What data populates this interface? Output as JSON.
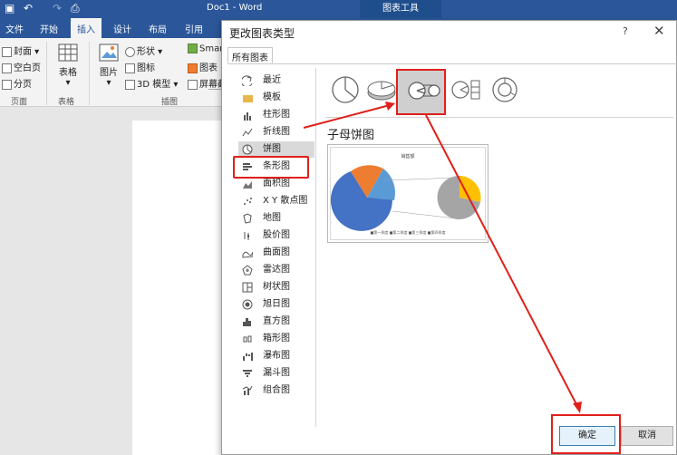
{
  "word": {
    "doc_title": "Doc1  -  Word",
    "tool_context_tab": "图表工具",
    "tabs": [
      "文件",
      "开始",
      "插入",
      "设计",
      "布局",
      "引用"
    ],
    "active_tab": "插入"
  },
  "ribbon": {
    "pages": {
      "items": [
        "封面",
        "空白页",
        "分页"
      ],
      "group": "页面"
    },
    "tables": {
      "label": "表格",
      "group": "表格"
    },
    "illustrations": {
      "picture": "图片",
      "shapes": "形状",
      "icons": "图标",
      "model3d": "3D 模型",
      "smartart": "Smar",
      "chart": "图表",
      "screenshot": "屏幕截",
      "group": "插图"
    }
  },
  "dialog": {
    "title": "更改图表类型",
    "help": "?",
    "close": "✕",
    "tab": "所有图表",
    "chart_types": [
      {
        "label": "最近",
        "icon": "recent-icon"
      },
      {
        "label": "模板",
        "icon": "folder-icon"
      },
      {
        "label": "柱形图",
        "icon": "column-chart-icon"
      },
      {
        "label": "折线图",
        "icon": "line-chart-icon"
      },
      {
        "label": "饼图",
        "icon": "pie-chart-icon"
      },
      {
        "label": "条形图",
        "icon": "bar-chart-icon"
      },
      {
        "label": "面积图",
        "icon": "area-chart-icon"
      },
      {
        "label": "X Y 散点图",
        "icon": "scatter-chart-icon"
      },
      {
        "label": "地图",
        "icon": "map-chart-icon"
      },
      {
        "label": "股价图",
        "icon": "stock-chart-icon"
      },
      {
        "label": "曲面图",
        "icon": "surface-chart-icon"
      },
      {
        "label": "雷达图",
        "icon": "radar-chart-icon"
      },
      {
        "label": "树状图",
        "icon": "treemap-chart-icon"
      },
      {
        "label": "旭日图",
        "icon": "sunburst-chart-icon"
      },
      {
        "label": "直方图",
        "icon": "histogram-chart-icon"
      },
      {
        "label": "箱形图",
        "icon": "box-chart-icon"
      },
      {
        "label": "瀑布图",
        "icon": "waterfall-chart-icon"
      },
      {
        "label": "漏斗图",
        "icon": "funnel-chart-icon"
      },
      {
        "label": "组合图",
        "icon": "combo-chart-icon"
      }
    ],
    "selected_type": "饼图",
    "subtypes": [
      "pie-icon",
      "3d-pie-icon",
      "pie-of-pie-icon",
      "bar-of-pie-icon",
      "doughnut-icon"
    ],
    "selected_subtype": "pie-of-pie-icon",
    "subtype_name": "子母饼图",
    "preview": {
      "title": "销售额",
      "legend": "■第一季度  ■第二季度  ■第三季度  ■第四季度"
    },
    "ok": "确定",
    "cancel": "取消"
  },
  "colors": {
    "word_blue": "#2b579a",
    "highlight_red": "#e0201b",
    "pie_blue": "#4472c4",
    "pie_orange": "#ed7d31",
    "pie_gray": "#a5a5a5",
    "pie_yellow": "#ffc000",
    "pie_lightblue": "#5b9bd5"
  }
}
